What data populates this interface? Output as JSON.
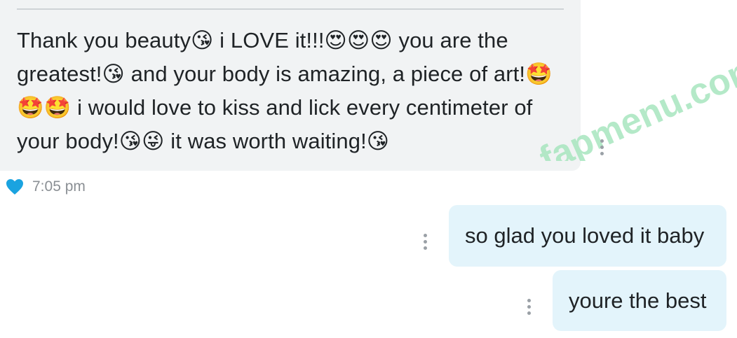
{
  "incoming_message": {
    "text": "Thank you beauty😘 i LOVE it!!!😍😍😍 you are the greatest!😘 and your body is amazing, a piece of art!🤩🤩🤩 i would love to kiss and lick every centimeter of your body!😘😜 it was worth waiting!😘",
    "line_1": "Thank you beauty😘 i LOVE it!!!😍😍😍 you are the",
    "line_2": "greatest!😘 and your body is amazing, a piece of art!🤩",
    "line_3": "🤩🤩 i would love to kiss and lick every centimeter of",
    "line_4": "your body!😘😜 it was worth waiting!😘",
    "timestamp": "7:05 pm",
    "reaction_icon": "heart-icon",
    "reaction_color": "#1aa3e0"
  },
  "outgoing_messages": [
    {
      "text": "so glad you loved it baby"
    },
    {
      "text": "youre the best"
    }
  ],
  "watermark": {
    "text": "fapmenu.com",
    "color": "#9fe0b4"
  },
  "colors": {
    "incoming_bubble": "#f1f3f4",
    "outgoing_bubble": "#e3f4fb"
  }
}
